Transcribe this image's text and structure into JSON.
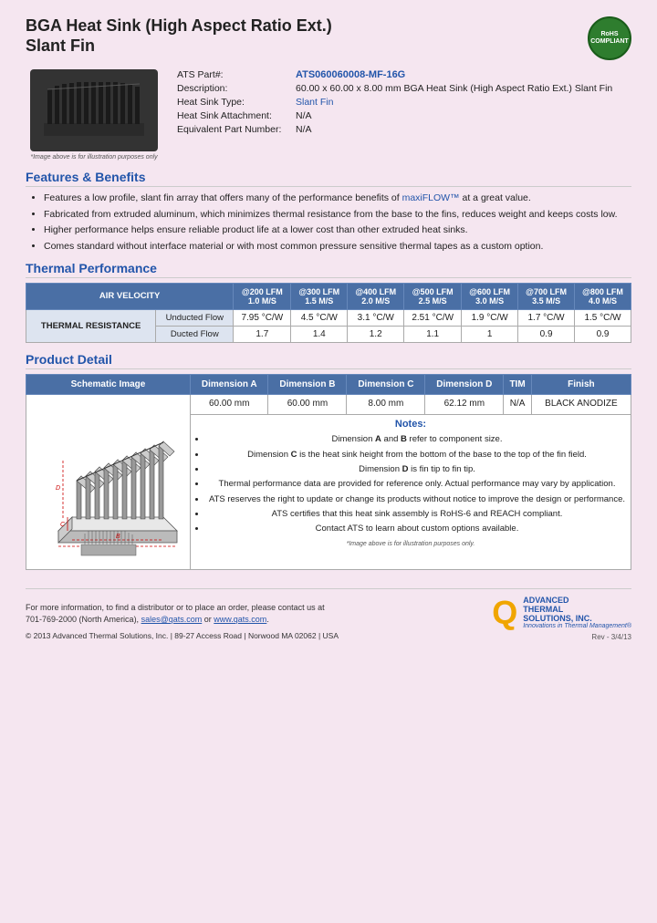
{
  "header": {
    "title_line1": "BGA Heat Sink (High Aspect Ratio Ext.)",
    "title_line2": "Slant Fin",
    "rohs_line1": "RoHS",
    "rohs_line2": "COMPLIANT"
  },
  "part_info": {
    "part_label": "ATS Part#:",
    "part_number": "ATS060060008-MF-16G",
    "desc_label": "Description:",
    "description": "60.00 x 60.00 x 8.00 mm  BGA Heat Sink (High Aspect Ratio Ext.) Slant Fin",
    "type_label": "Heat Sink Type:",
    "type_value": "Slant Fin",
    "attachment_label": "Heat Sink Attachment:",
    "attachment_value": "N/A",
    "equiv_label": "Equivalent Part Number:",
    "equiv_value": "N/A"
  },
  "image_caption": "*Image above is for illustration purposes only",
  "features": {
    "section_title": "Features & Benefits",
    "items": [
      "Features a low profile, slant fin array that offers many of the performance benefits of maxiFLOW™ at a great value.",
      "Fabricated from extruded aluminum, which minimizes thermal resistance from the base to the fins, reduces weight and keeps costs low.",
      "Higher performance helps ensure reliable product life at a lower cost than other extruded heat sinks.",
      "Comes standard without interface material or with most common pressure sensitive thermal tapes as a custom option."
    ]
  },
  "thermal_performance": {
    "section_title": "Thermal Performance",
    "header_row": {
      "col0": "AIR VELOCITY",
      "col1": "@200 LFM\n1.0 M/S",
      "col2": "@300 LFM\n1.5 M/S",
      "col3": "@400 LFM\n2.0 M/S",
      "col4": "@500 LFM\n2.5 M/S",
      "col5": "@600 LFM\n3.0 M/S",
      "col6": "@700 LFM\n3.5 M/S",
      "col7": "@800 LFM\n4.0 M/S"
    },
    "row_label": "THERMAL RESISTANCE",
    "unducted": {
      "label": "Unducted Flow",
      "values": [
        "7.95 °C/W",
        "4.5 °C/W",
        "3.1 °C/W",
        "2.51 °C/W",
        "1.9 °C/W",
        "1.7 °C/W",
        "1.5 °C/W"
      ]
    },
    "ducted": {
      "label": "Ducted Flow",
      "values": [
        "1.7",
        "1.4",
        "1.2",
        "1.1",
        "1",
        "0.9",
        "0.9"
      ]
    }
  },
  "product_detail": {
    "section_title": "Product Detail",
    "columns": [
      "Schematic Image",
      "Dimension A",
      "Dimension B",
      "Dimension C",
      "Dimension D",
      "TIM",
      "Finish"
    ],
    "dimensions": {
      "a": "60.00 mm",
      "b": "60.00 mm",
      "c": "8.00 mm",
      "d": "62.12 mm",
      "tim": "N/A",
      "finish": "BLACK ANODIZE"
    },
    "notes_title": "Notes:",
    "notes": [
      "Dimension A and B refer to component size.",
      "Dimension C is the heat sink height from the bottom of the base to the top of the fin field.",
      "Dimension D is fin tip to fin tip.",
      "Thermal performance data are provided for reference only. Actual performance may vary by application.",
      "ATS reserves the right to update or change its products without notice to improve the design or performance.",
      "ATS certifies that this heat sink assembly is RoHS-6 and REACH compliant.",
      "Contact ATS to learn about custom options available."
    ],
    "schematic_caption": "*Image above is for illustration purposes only."
  },
  "footer": {
    "contact_line1": "For more information, to find a distributor or to place an order, please contact us at",
    "contact_line2": "701-769-2000 (North America),",
    "email": "sales@qats.com",
    "or_text": " or ",
    "website": "www.qats.com",
    "copyright": "© 2013 Advanced Thermal Solutions, Inc.  |  89-27 Access Road  |  Norwood MA  02062  |  USA",
    "ats_q": "Q",
    "ats_name_line1": "ADVANCED",
    "ats_name_line2": "THERMAL",
    "ats_name_line3": "SOLUTIONS, INC.",
    "tagline": "Innovations in Thermal Management®",
    "page_num": "Rev - 3/4/13"
  }
}
